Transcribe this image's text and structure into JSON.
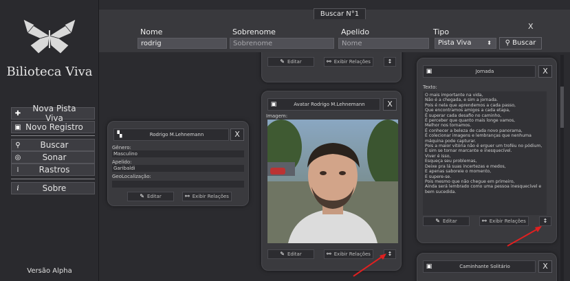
{
  "app": {
    "title": "Bilioteca Viva",
    "version": "Versão Alpha"
  },
  "sidebar": {
    "items": [
      {
        "label": "Nova Pista Viva",
        "icon": "new-trail-icon"
      },
      {
        "label": "Novo Registro",
        "icon": "new-record-icon"
      },
      {
        "label": "Buscar",
        "icon": "search-icon"
      },
      {
        "label": "Sonar",
        "icon": "sonar-icon"
      },
      {
        "label": "Rastros",
        "icon": "footprints-icon"
      },
      {
        "label": "Sobre",
        "icon": "info-icon"
      }
    ]
  },
  "search": {
    "tab_title": "Buscar N°1",
    "close": "X",
    "nome_label": "Nome",
    "nome_value": "rodrig",
    "sobrenome_label": "Sobrenome",
    "sobrenome_placeholder": "Sobrenome",
    "apelido_label": "Apelido",
    "apelido_placeholder": "Nome",
    "tipo_label": "Tipo",
    "tipo_value": "Pista Viva",
    "buscar_label": "Buscar"
  },
  "common": {
    "editar": "Editar",
    "exibir_relacoes": "Exibir Relações",
    "close": "X"
  },
  "person_card": {
    "title": "Rodrigo M.Lehnemann",
    "genero_label": "Gênero:",
    "genero_value": "Masculino",
    "apelido_label": "Apelido:",
    "apelido_value": "Garibaldi",
    "geo_label": "GeoLocalização:",
    "geo_value": ""
  },
  "avatar_card": {
    "title": "Avatar Rodrigo M.Lehnemann",
    "imagem_label": "Imagem:"
  },
  "jornada_card": {
    "title": "Jornada",
    "texto_label": "Texto:",
    "texto": "O mais importante na vida,\nNão é a chegada, e sim a jornada.\nPois é nela que aprendemos a cada passo,\nQue encontramos amigos a cada etapa,\nÉ superar cada desafio no caminho,\nÉ perceber que quanto mais longe vamos,\nMelhor nos tornamos.\nÉ conhecer a beleza de cada novo panorama,\nÉ colecionar imagens e lembranças que nenhuma máquina pode capturar.\nPois a maior vitória não é erguer um troféu no pódium,\nÉ sim se tornar marcante e inesquecível.\nViver é isso,\nEsqueça seu problemas,\nDeixe pra lá suas incertezas e medos,\nE apenas saboreie o momento,\nE supere-se.\nPois mesmo que não chegue em primeiro,\nAinda será lembrado como uma pessoa inesquecível e bem sucedida."
  },
  "caminhante_card": {
    "title": "Caminhante Solitário"
  }
}
